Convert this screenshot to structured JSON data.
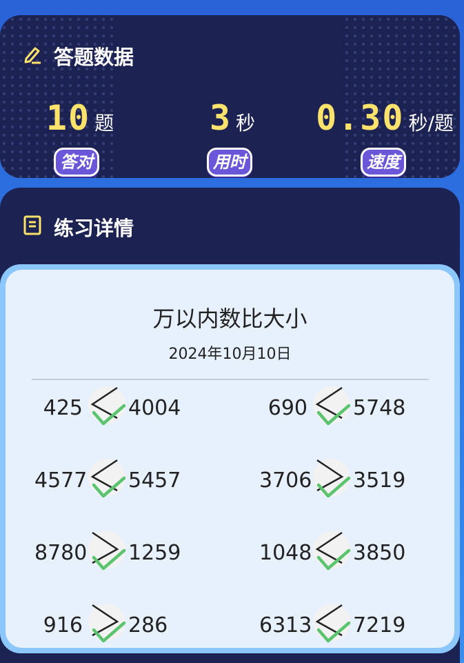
{
  "summary": {
    "title": "答题数据",
    "stats": [
      {
        "value": "10",
        "unit": "题",
        "label": "答对"
      },
      {
        "value": "3",
        "unit": "秒",
        "label": "用时"
      },
      {
        "value": "0.30",
        "unit": "秒/题",
        "label": "速度"
      }
    ],
    "accent": "#fde26b"
  },
  "details": {
    "title": "练习详情",
    "sheet_title": "万以内数比大小",
    "date": "2024年10月10日",
    "problems": [
      {
        "a": "425",
        "b": "4004",
        "answer": "<",
        "correct": true
      },
      {
        "a": "690",
        "b": "5748",
        "answer": "<",
        "correct": true
      },
      {
        "a": "4577",
        "b": "5457",
        "answer": "<",
        "correct": true
      },
      {
        "a": "3706",
        "b": "3519",
        "answer": ">",
        "correct": true
      },
      {
        "a": "8780",
        "b": "1259",
        "answer": ">",
        "correct": true
      },
      {
        "a": "1048",
        "b": "3850",
        "answer": "<",
        "correct": true
      },
      {
        "a": "916",
        "b": "286",
        "answer": ">",
        "correct": true
      },
      {
        "a": "6313",
        "b": "7219",
        "answer": "<",
        "correct": true
      }
    ],
    "check_color": "#5cc46f"
  }
}
